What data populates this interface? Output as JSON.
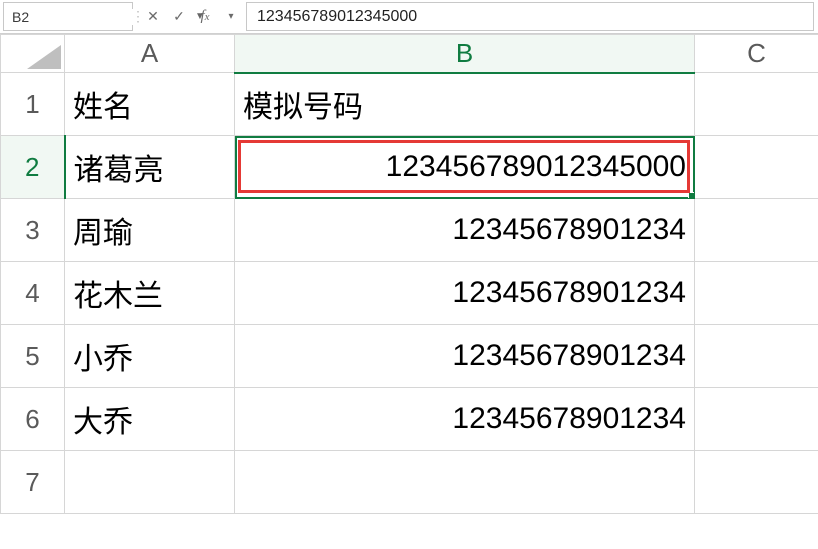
{
  "namebox": {
    "value": "B2"
  },
  "formula_bar": {
    "value": "123456789012345000"
  },
  "columns": [
    "A",
    "B",
    "C"
  ],
  "active_col_index": 1,
  "rows": [
    1,
    2,
    3,
    4,
    5,
    6,
    7
  ],
  "active_row_index": 1,
  "headers": {
    "A": "姓名",
    "B": "模拟号码"
  },
  "data": [
    {
      "name": "诸葛亮",
      "code": "123456789012345000"
    },
    {
      "name": "周瑜",
      "code": "12345678901234"
    },
    {
      "name": "花木兰",
      "code": "12345678901234"
    },
    {
      "name": "小乔",
      "code": "12345678901234"
    },
    {
      "name": "大乔",
      "code": "12345678901234"
    }
  ],
  "highlight": {
    "cell": "B2",
    "color": "#e53935"
  }
}
